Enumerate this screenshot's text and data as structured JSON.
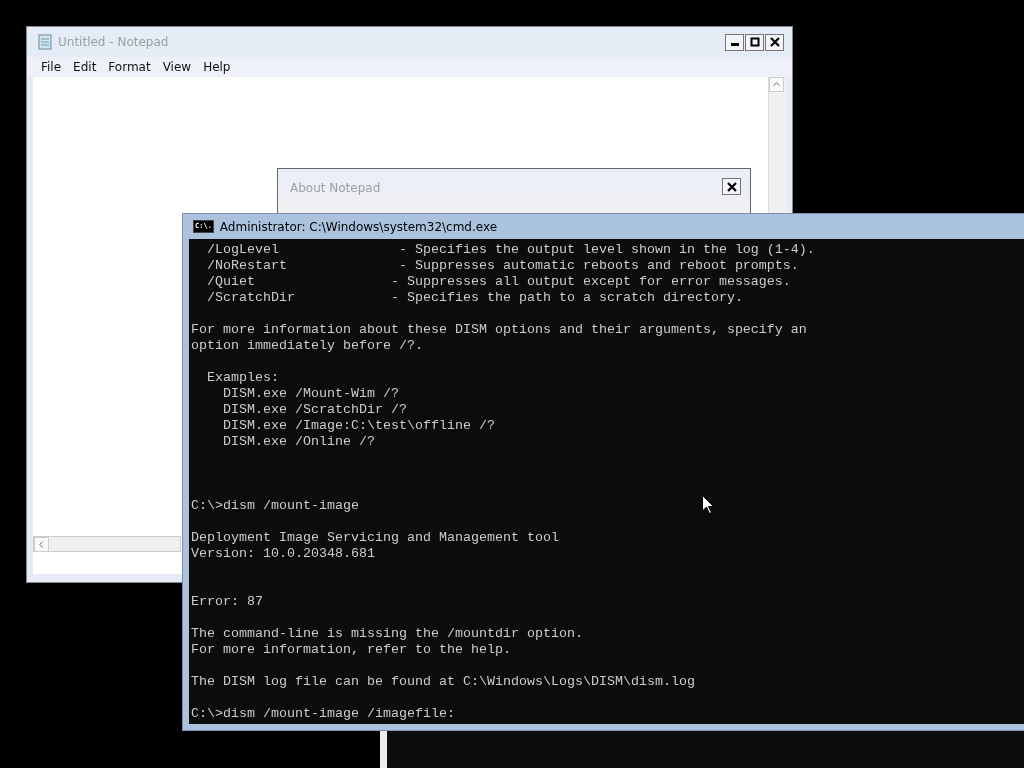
{
  "notepad": {
    "title": "Untitled - Notepad",
    "active": false,
    "menu": [
      "File",
      "Edit",
      "Format",
      "View",
      "Help"
    ]
  },
  "about_dialog": {
    "title": "About Notepad"
  },
  "cmd": {
    "title": "Administrator: C:\\Windows\\system32\\cmd.exe",
    "icon_text": "C:\\.",
    "lines": [
      {
        "kind": "text",
        "text": "  /LogLevel               - Specifies the output level shown in the log (1-4)."
      },
      {
        "kind": "text",
        "text": "  /NoRestart              - Suppresses automatic reboots and reboot prompts."
      },
      {
        "kind": "text",
        "text": "  /Quiet                 - Suppresses all output except for error messages."
      },
      {
        "kind": "text",
        "text": "  /ScratchDir            - Specifies the path to a scratch directory."
      },
      {
        "kind": "blank"
      },
      {
        "kind": "text",
        "text": "For more information about these DISM options and their arguments, specify an"
      },
      {
        "kind": "text",
        "text": "option immediately before /?."
      },
      {
        "kind": "blank"
      },
      {
        "kind": "text",
        "text": "  Examples:"
      },
      {
        "kind": "text",
        "text": "    DISM.exe /Mount-Wim /?"
      },
      {
        "kind": "text",
        "text": "    DISM.exe /ScratchDir /?"
      },
      {
        "kind": "text",
        "text": "    DISM.exe /Image:C:\\test\\offline /?"
      },
      {
        "kind": "text",
        "text": "    DISM.exe /Online /?"
      },
      {
        "kind": "blank"
      },
      {
        "kind": "blank"
      },
      {
        "kind": "blank"
      },
      {
        "kind": "text",
        "text": "C:\\>dism /mount-image"
      },
      {
        "kind": "blank"
      },
      {
        "kind": "text",
        "text": "Deployment Image Servicing and Management tool"
      },
      {
        "kind": "text",
        "text": "Version: 10.0.20348.681"
      },
      {
        "kind": "blank"
      },
      {
        "kind": "blank"
      },
      {
        "kind": "text",
        "text": "Error: 87"
      },
      {
        "kind": "blank"
      },
      {
        "kind": "text",
        "text": "The command-line is missing the /mountdir option."
      },
      {
        "kind": "text",
        "text": "For more information, refer to the help."
      },
      {
        "kind": "blank"
      },
      {
        "kind": "text",
        "text": "The DISM log file can be found at C:\\Windows\\Logs\\DISM\\dism.log"
      },
      {
        "kind": "blank"
      },
      {
        "kind": "text",
        "text": "C:\\>dism /mount-image /imagefile:"
      }
    ]
  }
}
